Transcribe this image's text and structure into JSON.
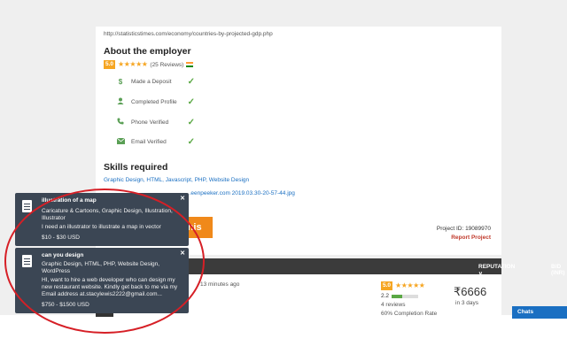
{
  "project": {
    "url": "http://statisticstimes.com/economy/countries-by-projected-gdp.php",
    "attachment": "...eenpeeker.com 2019.03.30-20-57-44.jpg",
    "bid_button_fragment": "this",
    "project_id_label": "Project ID: 19089970",
    "report_label": "Report Project"
  },
  "employer": {
    "heading": "About the employer",
    "rating": "5.0",
    "stars": "★★★★★",
    "reviews": "(25 Reviews)",
    "verifications": [
      {
        "label": "Made a Deposit",
        "icon": "dollar-icon"
      },
      {
        "label": "Completed Profile",
        "icon": "user-icon"
      },
      {
        "label": "Phone Verified",
        "icon": "phone-icon"
      },
      {
        "label": "Email Verified",
        "icon": "email-icon"
      }
    ]
  },
  "skills": {
    "heading": "Skills required",
    "list": "Graphic Design, HTML, Javascript, PHP, Website Design"
  },
  "table": {
    "reputation_header": "REPUTATION",
    "bid_header": "BID (INR)",
    "row": {
      "time_ago": "· 13 minutes ago",
      "rating": "5.0",
      "stars": "★★★★★",
      "score": "2.2",
      "reviews": "4 reviews",
      "completion": "60% Completion Rate",
      "bid": "₹6666",
      "days": "in 3 days"
    }
  },
  "chats": {
    "label": "Chats"
  },
  "notifications": [
    {
      "title": "illustration of a map",
      "skills": "Caricature & Cartoons, Graphic Design, Illustration, Illustrator",
      "description": "I need an illustrator to illustrate a map in vector",
      "budget": "$10 - $30 USD"
    },
    {
      "title": "can you design",
      "skills": "Graphic Design, HTML, PHP, Website Design, WordPress",
      "description": "HI, want to hire a web developer who can design my new restaurant website. Kindly get back to me via my Email address at.stacylewis2222@gmail.com...",
      "budget": "$750 - $1500 USD"
    }
  ],
  "colors": {
    "accent_orange": "#f0891a",
    "star_color": "#f6a623",
    "link_blue": "#1a6fc2",
    "notification_bg": "#3b4654",
    "highlight_red": "#d61f26"
  }
}
